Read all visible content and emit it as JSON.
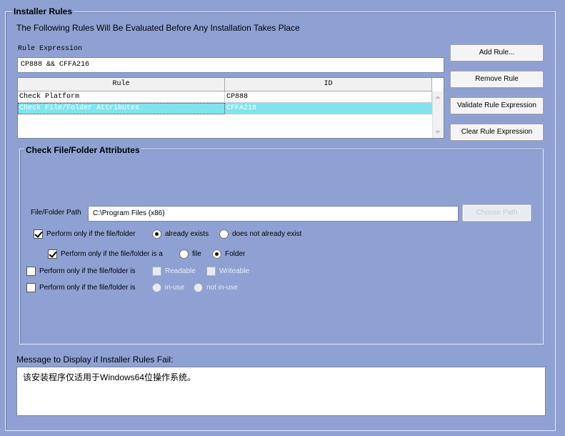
{
  "installer_rules": {
    "title": "Installer Rules",
    "subtitle": "The Following Rules Will Be Evaluated Before Any Installation Takes Place",
    "rule_expression_label": "Rule Expression",
    "rule_expression_value": "CP888 && CFFA216",
    "grid": {
      "columns": [
        "Rule",
        "ID"
      ],
      "rows": [
        {
          "rule": "Check Platform",
          "id": "CP888",
          "selected": false
        },
        {
          "rule": "Check File/Folder Attributes",
          "id": "CFFA216",
          "selected": true
        }
      ]
    },
    "buttons": {
      "add_rule": "Add Rule...",
      "remove_rule": "Remove Rule",
      "validate": "Validate Rule Expression",
      "clear": "Clear Rule Expression"
    }
  },
  "file_folder_attributes": {
    "title": "Check File/Folder Attributes",
    "path_label": "File/Folder Path",
    "path_value": "C:\\Program Files (x86)",
    "browse_button": "Choose Path",
    "exists_row": {
      "checkbox_label": "Perform only if the file/folder",
      "checked": true,
      "options": [
        "already exists",
        "does not already exist"
      ],
      "selected": "already exists"
    },
    "type_row": {
      "checkbox_label": "Perform only if the file/folder is a",
      "checked": true,
      "options": [
        "file",
        "Folder"
      ],
      "selected": "Folder"
    },
    "access_row": {
      "checkbox_label": "Perform only if the file/folder is",
      "checked": false,
      "options": [
        "Readable",
        "Writeable"
      ]
    },
    "use_row": {
      "checkbox_label": "Perform only if the file/folder is",
      "checked": false,
      "options": [
        "in-use",
        "not in-use"
      ]
    }
  },
  "failure_message": {
    "label": "Message to Display if Installer Rules Fail:",
    "value": "该安装程序仅适用于Windows64位操作系统。"
  }
}
